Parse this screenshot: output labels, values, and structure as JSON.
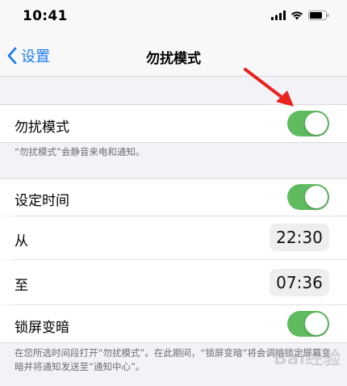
{
  "status_bar": {
    "time": "10:41"
  },
  "nav": {
    "back_label": "设置",
    "title": "勿扰模式"
  },
  "dnd": {
    "label": "勿扰模式",
    "enabled": true,
    "footnote": "“勿扰模式”会静音来电和通知。"
  },
  "schedule": {
    "label": "设定时间",
    "enabled": true,
    "from_label": "从",
    "from_time": "22:30",
    "to_label": "至",
    "to_time": "07:36",
    "dim_label": "锁屏变暗",
    "dim_enabled": true,
    "footnote": "在您所选时间段打开“勿扰模式”。在此期间，“锁屏变暗”将会调暗锁定屏幕变暗并将通知发送至“通知中心”。"
  },
  "colors": {
    "accent": "#1a7cf0",
    "switch_on": "#5fbb5f",
    "arrow": "#e8231f"
  },
  "watermark": "Bai经验"
}
